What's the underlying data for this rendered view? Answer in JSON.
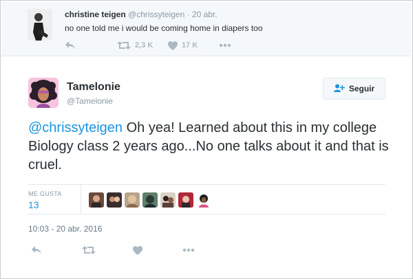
{
  "parent_tweet": {
    "name": "christine teigen",
    "handle": "@chrissyteigen",
    "date": "20 abr.",
    "text": "no one told me i would be coming home in diapers too",
    "retweets": "2,3 K",
    "likes": "17 K"
  },
  "main_tweet": {
    "name": "Tamelonie",
    "handle": "@Tamelonie",
    "follow_label": "Seguir",
    "mention": "@chrissyteigen",
    "text": " Oh yea! Learned about this in my college Biology class 2 years ago...No one talks about it and that is cruel.",
    "likes_label": "ME GUSTA",
    "likes_count": "13",
    "timestamp": "10:03 - 20 abr. 2016"
  },
  "colors": {
    "link": "#1b95e0",
    "icon": "#aab8c2",
    "muted": "#8899a6",
    "text": "#292f33"
  },
  "icons": {
    "reply": "reply-icon",
    "retweet": "retweet-icon",
    "like": "heart-icon",
    "more": "more-icon",
    "follow": "add-user-icon"
  }
}
